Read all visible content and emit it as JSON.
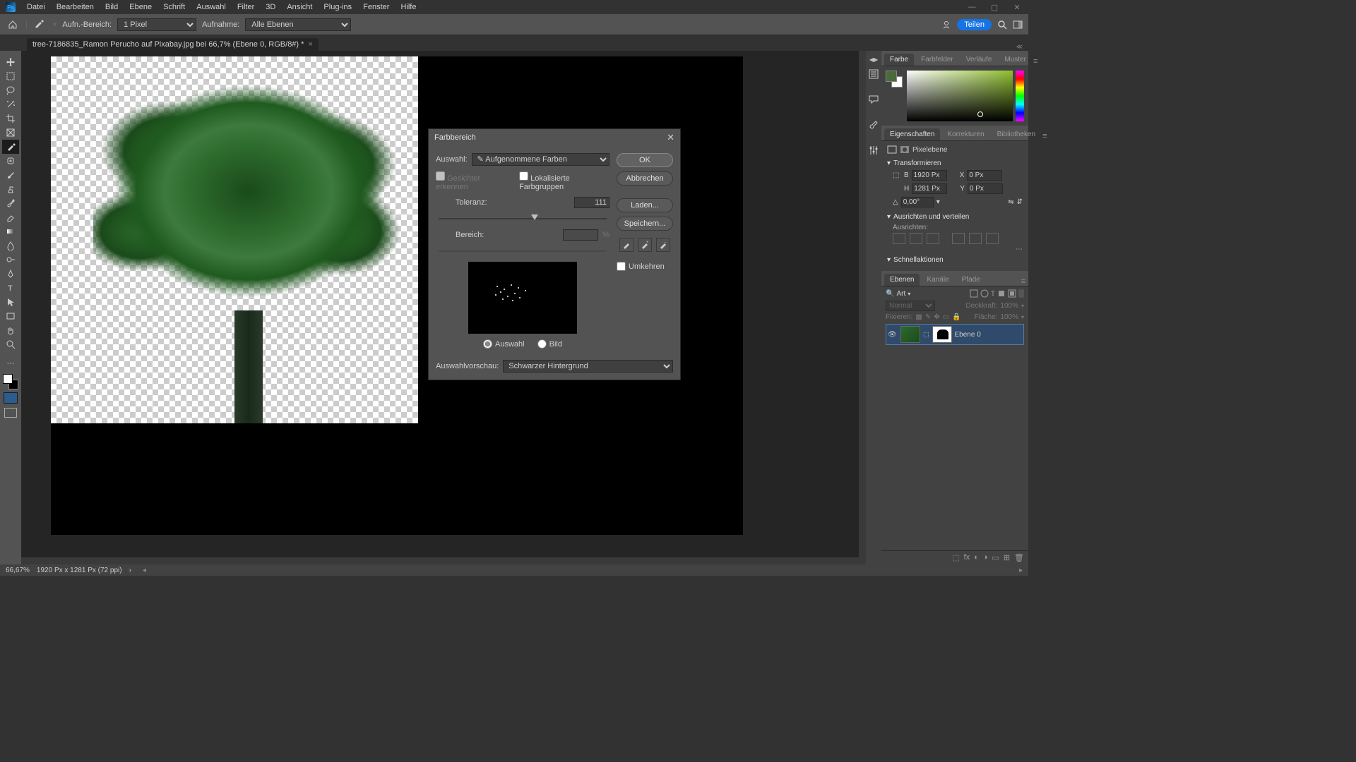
{
  "menu": {
    "items": [
      "Datei",
      "Bearbeiten",
      "Bild",
      "Ebene",
      "Schrift",
      "Auswahl",
      "Filter",
      "3D",
      "Ansicht",
      "Plug-ins",
      "Fenster",
      "Hilfe"
    ]
  },
  "options": {
    "aufnbereich_label": "Aufn.-Bereich:",
    "aufnbereich_value": "1 Pixel",
    "aufnahme_label": "Aufnahme:",
    "aufnahme_value": "Alle Ebenen",
    "share_label": "Teilen"
  },
  "doctab": {
    "title": "tree-7186835_Ramon Perucho auf Pixabay.jpg bei 66,7% (Ebene 0, RGB/8#) *"
  },
  "dialog": {
    "title": "Farbbereich",
    "auswahl_label": "Auswahl:",
    "auswahl_value": "✎ Aufgenommene Farben",
    "gesichter": "Gesichter erkennen",
    "lokalisierte": "Lokalisierte Farbgruppen",
    "toleranz_label": "Toleranz:",
    "toleranz_value": "111",
    "bereich_label": "Bereich:",
    "bereich_value": "",
    "bereich_unit": "%",
    "radio_auswahl": "Auswahl",
    "radio_bild": "Bild",
    "vorschau_label": "Auswahlvorschau:",
    "vorschau_value": "Schwarzer Hintergrund",
    "ok": "OK",
    "abbrechen": "Abbrechen",
    "laden": "Laden...",
    "speichern": "Speichern...",
    "umkehren": "Umkehren"
  },
  "right_tabs": {
    "farbe": [
      "Farbe",
      "Farbfelder",
      "Verläufe",
      "Muster"
    ],
    "eigenschaften": [
      "Eigenschaften",
      "Korrekturen",
      "Bibliotheken"
    ],
    "ebenen": [
      "Ebenen",
      "Kanäle",
      "Pfade"
    ]
  },
  "properties": {
    "type": "Pixelebene",
    "transformieren": "Transformieren",
    "B_label": "B",
    "B_value": "1920 Px",
    "X_label": "X",
    "X_value": "0 Px",
    "H_label": "H",
    "H_value": "1281 Px",
    "Y_label": "Y",
    "Y_value": "0 Px",
    "angle": "0,00°",
    "ausrichten_head": "Ausrichten und verteilen",
    "ausrichten_label": "Ausrichten:",
    "schnellaktionen": "Schnellaktionen"
  },
  "layers": {
    "filter_label": "Art",
    "blend_mode": "Normal",
    "deckkraft_label": "Deckkraft:",
    "deckkraft_value": "100%",
    "fixieren_label": "Fixieren:",
    "flaeche_label": "Fläche:",
    "flaeche_value": "100%",
    "layer0": "Ebene 0"
  },
  "status": {
    "zoom": "66,67%",
    "docinfo": "1920 Px x 1281 Px (72 ppi)"
  }
}
